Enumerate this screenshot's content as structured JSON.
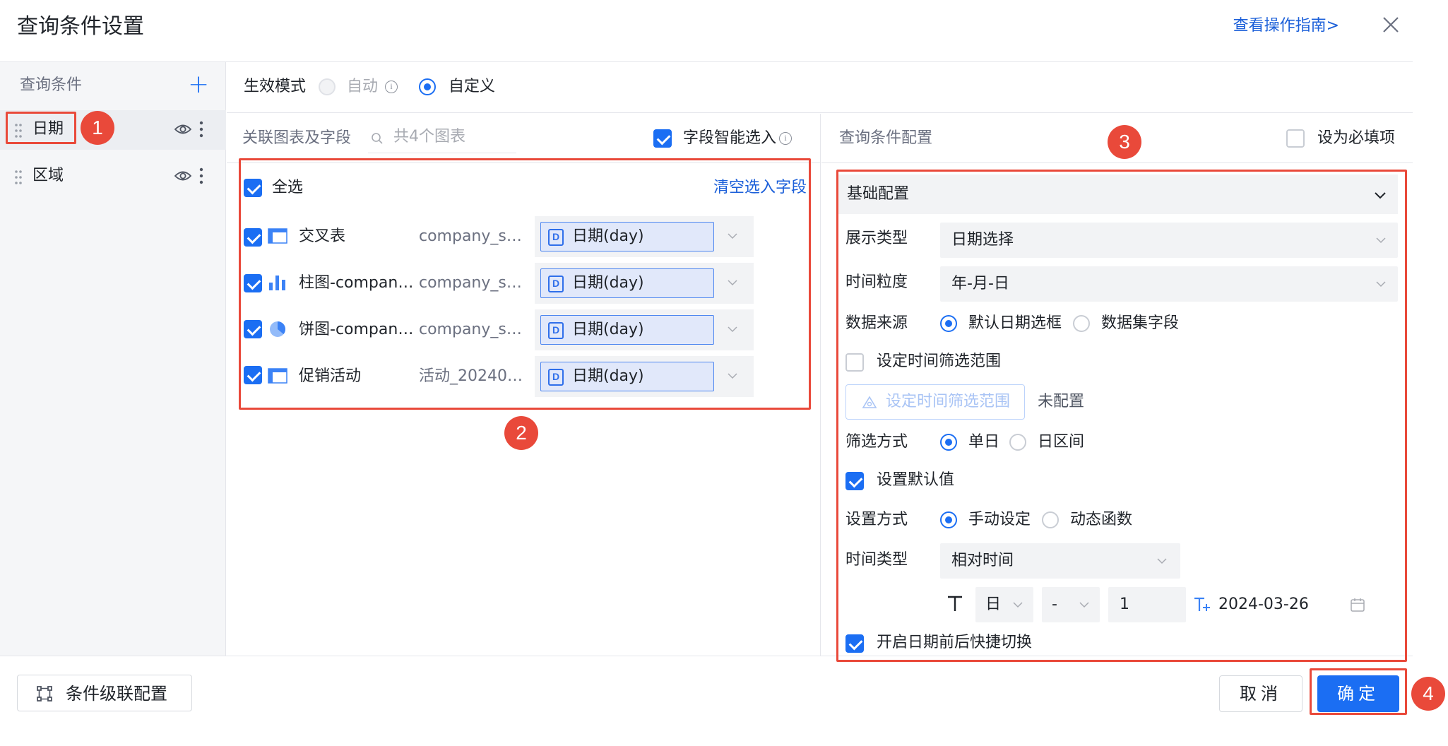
{
  "header": {
    "title": "查询条件设置",
    "guide_link": "查看操作指南>"
  },
  "left_panel": {
    "title": "查询条件",
    "items": [
      {
        "label": "日期"
      },
      {
        "label": "区域"
      }
    ]
  },
  "mode": {
    "label": "生效模式",
    "options": [
      "自动",
      "自定义"
    ],
    "selected": "自定义"
  },
  "middle": {
    "header_label": "关联图表及字段",
    "search_placeholder": "共4个图表",
    "smart_select_label": "字段智能选入",
    "select_all_label": "全选",
    "clear_link": "清空选入字段",
    "rows": [
      {
        "chart_icon": "crosstable-icon",
        "name": "交叉表",
        "dataset": "company_sal...",
        "field": "日期(day)"
      },
      {
        "chart_icon": "bar-chart-icon",
        "name": "柱图-company...",
        "dataset": "company_sal...",
        "field": "日期(day)"
      },
      {
        "chart_icon": "pie-chart-icon",
        "name": "饼图-company...",
        "dataset": "company_sal...",
        "field": "日期(day)"
      },
      {
        "chart_icon": "crosstable-icon",
        "name": "促销活动",
        "dataset": "活动_202403...",
        "field": "日期(day)"
      }
    ]
  },
  "right": {
    "header_label": "查询条件配置",
    "required_label": "设为必填项",
    "section_title": "基础配置",
    "display_type": {
      "label": "展示类型",
      "value": "日期选择"
    },
    "granularity": {
      "label": "时间粒度",
      "value": "年-月-日"
    },
    "data_source": {
      "label": "数据来源",
      "options": [
        "默认日期选框",
        "数据集字段"
      ],
      "selected": "默认日期选框"
    },
    "time_range": {
      "checkbox_label": "设定时间筛选范围",
      "button_label": "设定时间筛选范围",
      "status": "未配置"
    },
    "filter_mode": {
      "label": "筛选方式",
      "options": [
        "单日",
        "日区间"
      ],
      "selected": "单日"
    },
    "default_value": {
      "checkbox_label": "设置默认值"
    },
    "set_mode": {
      "label": "设置方式",
      "options": [
        "手动设定",
        "动态函数"
      ],
      "selected": "手动设定"
    },
    "time_type": {
      "label": "时间类型",
      "value": "相对时间"
    },
    "relative": {
      "unit": "日",
      "sign": "-",
      "amount": "1",
      "result_date": "2024-03-26"
    },
    "quick_switch_label": "开启日期前后快捷切换"
  },
  "footer": {
    "cascade_label": "条件级联配置",
    "cancel_label": "取消",
    "ok_label": "确定"
  },
  "annotations": [
    "1",
    "2",
    "3",
    "4"
  ],
  "colors": {
    "accent": "#1b6ef3",
    "highlight": "#e9493a"
  }
}
